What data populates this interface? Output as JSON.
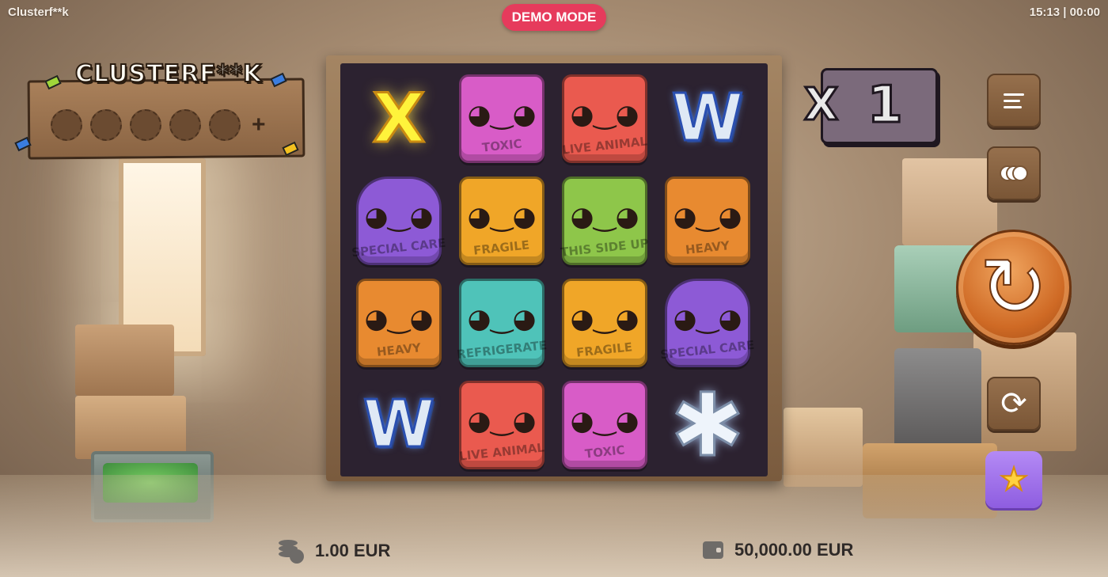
{
  "header": {
    "app_title": "Clusterf**k",
    "mode_badge": "DEMO MODE",
    "clock": "15:13 | 00:00"
  },
  "logo": {
    "text": "CLUSTERF**K",
    "collection_slots": 5,
    "collected": 0,
    "plus_symbol": "+"
  },
  "reels": {
    "rows": 4,
    "cols": 4,
    "symbols": [
      [
        {
          "type": "x-icon",
          "label": ""
        },
        {
          "type": "toxic-box",
          "label": "TOXIC",
          "color": "#d85cc7"
        },
        {
          "type": "live-animal-box",
          "label": "LIVE ANIMAL",
          "color": "#ea5a4f"
        },
        {
          "type": "w-icon",
          "label": ""
        }
      ],
      [
        {
          "type": "special-care-box",
          "label": "SPECIAL CARE",
          "color": "#8d5ad6"
        },
        {
          "type": "fragile-box",
          "label": "FRAGILE",
          "color": "#f0a628"
        },
        {
          "type": "this-side-up-box",
          "label": "THIS SIDE UP",
          "color": "#8ec64a"
        },
        {
          "type": "heavy-box",
          "label": "HEAVY",
          "color": "#e88a30"
        }
      ],
      [
        {
          "type": "heavy-box",
          "label": "HEAVY",
          "color": "#e88a30"
        },
        {
          "type": "refrigerate-box",
          "label": "REFRIGERATE",
          "color": "#4fc3b9"
        },
        {
          "type": "fragile-box",
          "label": "FRAGILE",
          "color": "#f0a628"
        },
        {
          "type": "special-care-box",
          "label": "SPECIAL CARE",
          "color": "#8d5ad6"
        }
      ],
      [
        {
          "type": "w-icon",
          "label": ""
        },
        {
          "type": "live-animal-box",
          "label": "LIVE ANIMAL",
          "color": "#ea5a4f"
        },
        {
          "type": "toxic-box",
          "label": "TOXIC",
          "color": "#d85cc7"
        },
        {
          "type": "snowflake-icon",
          "label": ""
        }
      ]
    ],
    "x_symbol": "X",
    "w_symbol": "W",
    "star_symbol": "✱"
  },
  "multiplier": {
    "prefix": "X",
    "value": "1"
  },
  "controls": {
    "menu_icon": "menu-icon",
    "bet_levels_icon": "coin-stack-icon",
    "spin_icon": "spin-icon",
    "spin_glyph": "↻",
    "autoplay_icon": "autoplay-icon",
    "autoplay_glyph": "⟳",
    "bonus_icon": "star-icon",
    "bonus_glyph": "★"
  },
  "footer": {
    "bet": "1.00 EUR",
    "balance": "50,000.00 EUR"
  },
  "colors": {
    "demo_badge": "#e63b5c",
    "spin_button": "#cf6a25",
    "bonus_button": "#a777ee",
    "reel_background": "#2c2230"
  }
}
